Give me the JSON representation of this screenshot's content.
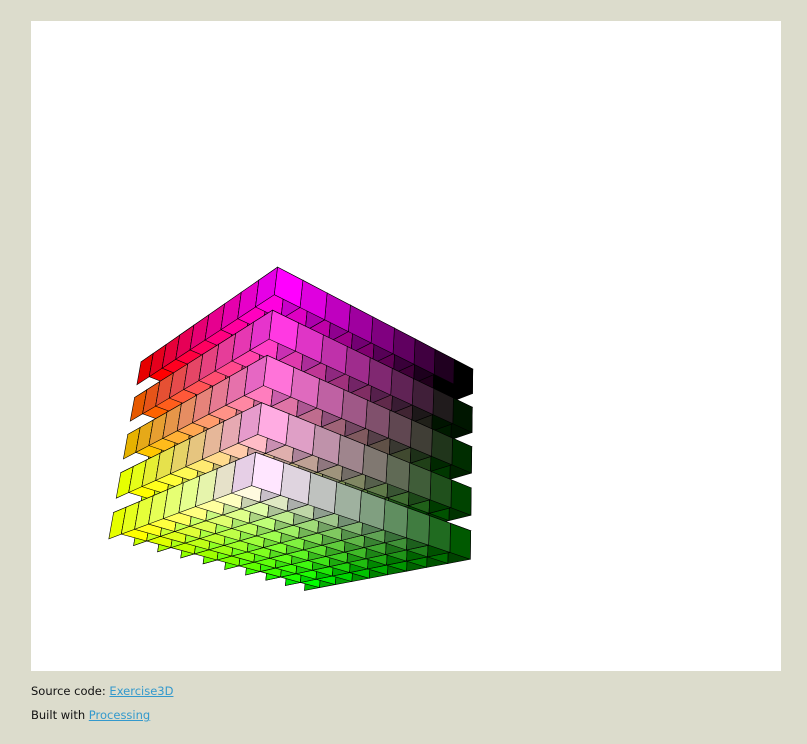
{
  "sketch": {
    "description_colors": {
      "canvas_bg": "#ffffff",
      "page_bg": "#dcdccc",
      "outline": "#000000"
    }
  },
  "footer": {
    "source_label": "Source code: ",
    "source_link": "Exercise3D",
    "built_label": "Built with ",
    "built_link": "Processing",
    "link_color": "#3399cc"
  }
}
